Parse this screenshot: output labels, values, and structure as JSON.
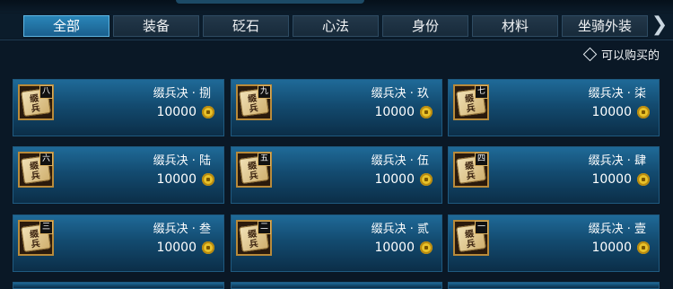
{
  "tabs": [
    {
      "label": "全部",
      "active": true
    },
    {
      "label": "装备"
    },
    {
      "label": "砭石"
    },
    {
      "label": "心法"
    },
    {
      "label": "身份"
    },
    {
      "label": "材料"
    },
    {
      "label": "坐骑外装"
    }
  ],
  "filter": {
    "label": "可以购买的"
  },
  "items": [
    {
      "name": "缀兵决 · 捌",
      "rank": "八",
      "price": "10000"
    },
    {
      "name": "缀兵决 · 玖",
      "rank": "九",
      "price": "10000"
    },
    {
      "name": "缀兵决 · 柒",
      "rank": "七",
      "price": "10000"
    },
    {
      "name": "缀兵决 · 陆",
      "rank": "六",
      "price": "10000"
    },
    {
      "name": "缀兵决 · 伍",
      "rank": "五",
      "price": "10000"
    },
    {
      "name": "缀兵决 · 肆",
      "rank": "四",
      "price": "10000"
    },
    {
      "name": "缀兵决 · 叁",
      "rank": "三",
      "price": "10000"
    },
    {
      "name": "缀兵决 · 贰",
      "rank": "二",
      "price": "10000"
    },
    {
      "name": "缀兵决 · 壹",
      "rank": "一",
      "price": "10000"
    }
  ],
  "icon_glyph": "缀兵",
  "colors": {
    "accent": "#2a86b8",
    "coin": "#e8c22a",
    "card": "#1f6a98"
  }
}
